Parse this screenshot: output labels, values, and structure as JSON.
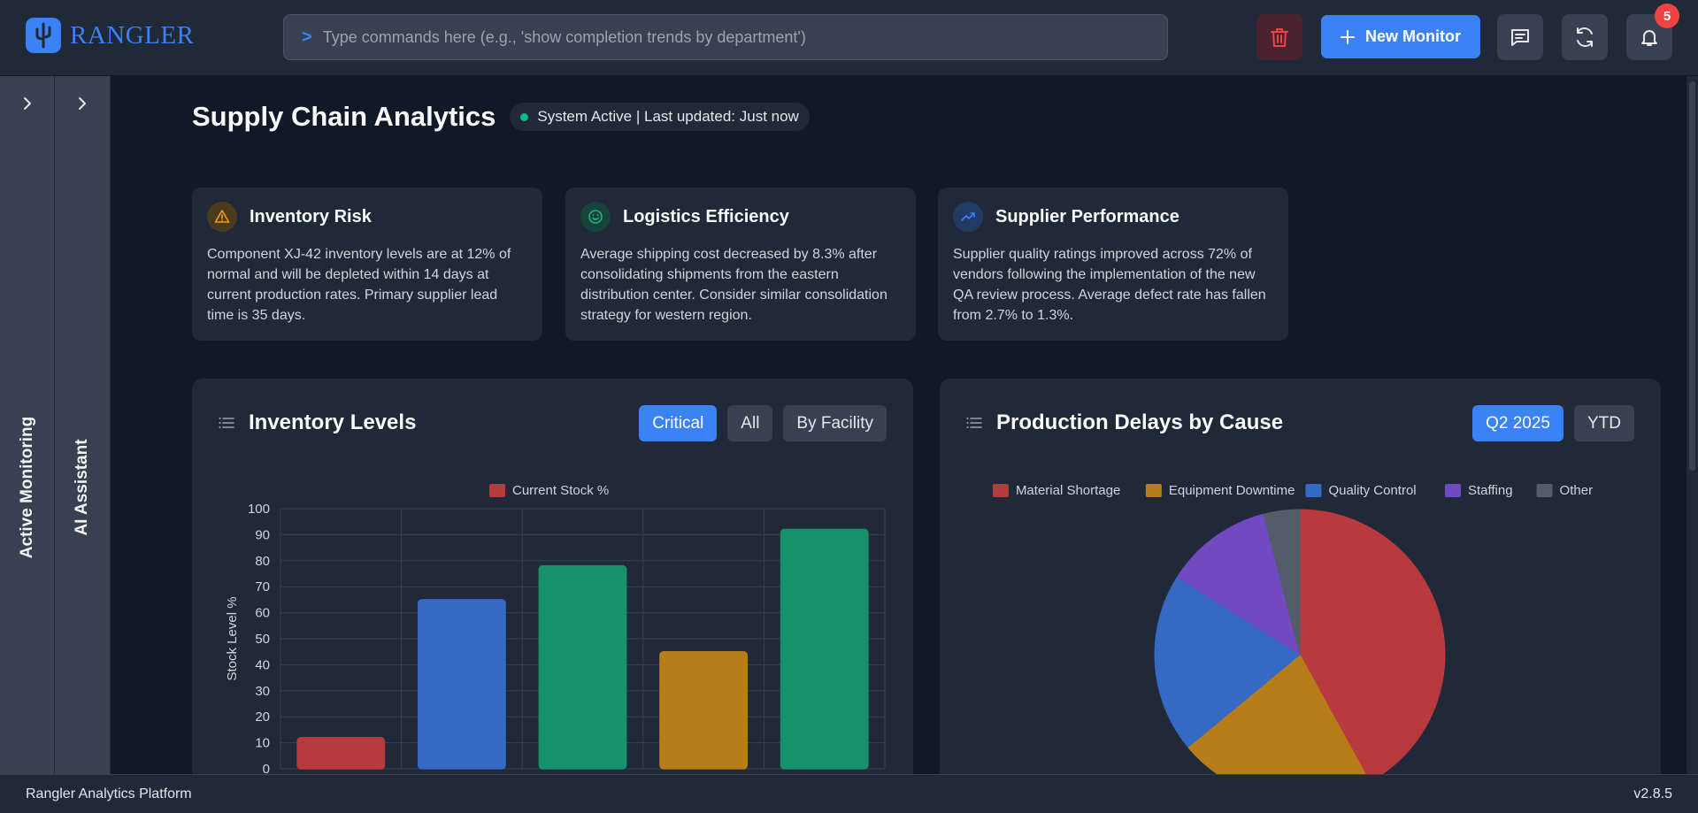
{
  "app": {
    "name": "RANGLER",
    "version": "v2.8.5",
    "footer_label": "Rangler Analytics Platform"
  },
  "command": {
    "prompt_symbol": ">",
    "placeholder": "Type commands here (e.g., 'show completion trends by department')"
  },
  "header": {
    "new_monitor_label": "New Monitor",
    "notification_count": "5"
  },
  "sidebars": {
    "monitoring_label": "Active Monitoring",
    "assistant_label": "AI Assistant"
  },
  "page": {
    "title": "Supply Chain Analytics",
    "status": "System Active | Last updated: Just now"
  },
  "cards": [
    {
      "title": "Inventory Risk",
      "icon": "warning-icon",
      "color": "#f59e0b",
      "body": "Component XJ-42 inventory levels are at 12% of normal and will be depleted within 14 days at current production rates. Primary supplier lead time is 35 days."
    },
    {
      "title": "Logistics Efficiency",
      "icon": "smile-icon",
      "color": "#10b981",
      "body": "Average shipping cost decreased by 8.3% after consolidating shipments from the eastern distribution center. Consider similar consolidation strategy for western region."
    },
    {
      "title": "Supplier Performance",
      "icon": "trend-up-icon",
      "color": "#3b82f6",
      "body": "Supplier quality ratings improved across 72% of vendors following the implementation of the new QA review process. Average defect rate has fallen from 2.7% to 1.3%."
    }
  ],
  "panels": {
    "inventory": {
      "title": "Inventory Levels",
      "filters": [
        "Critical",
        "All",
        "By Facility"
      ],
      "active": "Critical"
    },
    "delays": {
      "title": "Production Delays by Cause",
      "filters": [
        "Q2 2025",
        "YTD"
      ],
      "active": "Q2 2025"
    }
  },
  "chart_data": [
    {
      "type": "bar",
      "legend": [
        "Current Stock %"
      ],
      "ylabel": "Stock Level %",
      "ylim": [
        0,
        100
      ],
      "yticks": [
        0,
        10,
        20,
        30,
        40,
        50,
        60,
        70,
        80,
        90,
        100
      ],
      "values": [
        12,
        65,
        78,
        45,
        92
      ],
      "colors": [
        "#b83a3f",
        "#3469c4",
        "#17916a",
        "#b67d18",
        "#17916a"
      ],
      "grid": true
    },
    {
      "type": "pie",
      "legend_position": "top",
      "labels": [
        "Material Shortage",
        "Equipment Downtime",
        "Quality Control",
        "Staffing",
        "Other"
      ],
      "values": [
        42,
        22,
        20,
        12,
        4
      ],
      "colors": [
        "#b83a3f",
        "#b67d18",
        "#3469c4",
        "#7149c1",
        "#535c69"
      ]
    }
  ]
}
